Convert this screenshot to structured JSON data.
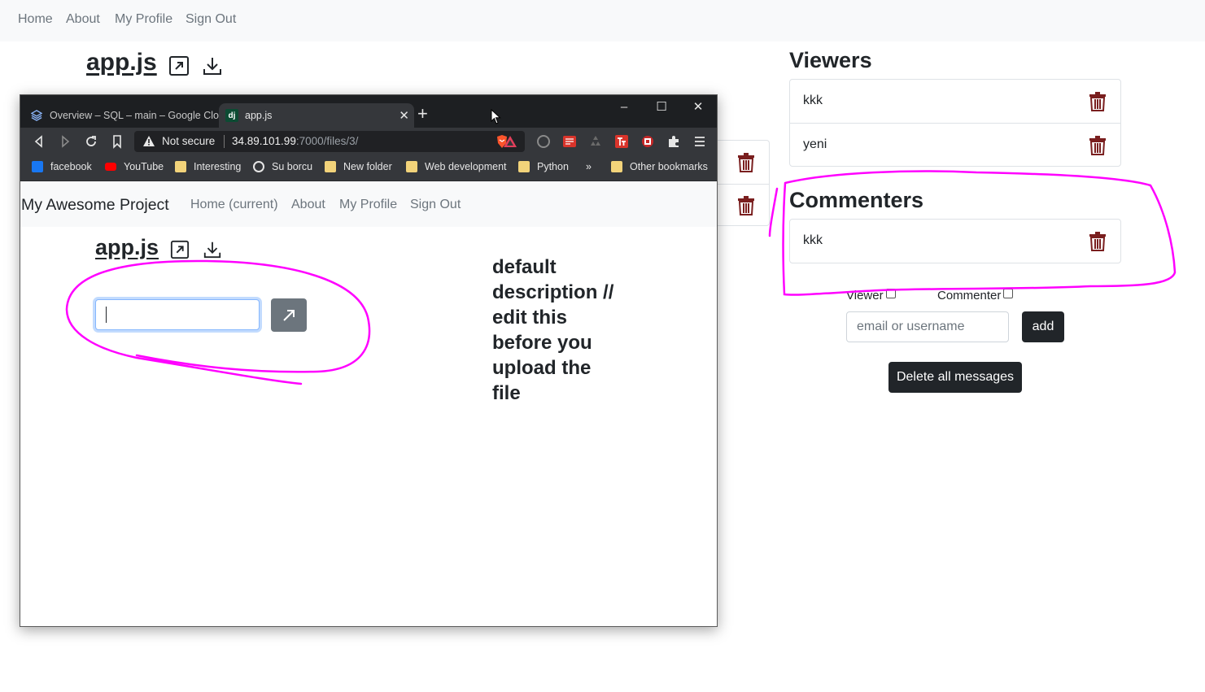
{
  "outer_nav": {
    "items": [
      "Home",
      "About",
      "My Profile",
      "Sign Out"
    ]
  },
  "outer_file": {
    "title": "app.js"
  },
  "viewers": {
    "title": "Viewers",
    "items": [
      "kkk",
      "yeni"
    ]
  },
  "commenters": {
    "title": "Commenters",
    "items": [
      "kkk"
    ]
  },
  "invite": {
    "viewer_label": "Viewer",
    "commenter_label": "Commenter",
    "placeholder": "email or username",
    "add_label": "add",
    "delete_all_label": "Delete all messages"
  },
  "browser": {
    "tabs": [
      {
        "label": "Overview – SQL – main – Google Cloud",
        "active": false
      },
      {
        "label": "app.js",
        "active": true
      }
    ],
    "address": {
      "security_label": "Not secure",
      "host": "34.89.101.99",
      "path": ":7000/files/3/"
    },
    "bookmarks": [
      "facebook",
      "YouTube",
      "Interesting",
      "Su borcu",
      "New folder",
      "Web development",
      "Python",
      "»",
      "Other bookmarks"
    ]
  },
  "inner_page": {
    "brand": "My Awesome Project",
    "nav": [
      "Home (current)",
      "About",
      "My Profile",
      "Sign Out"
    ],
    "file_title": "app.js",
    "input_value": "",
    "description": "default description // edit this before you upload the file"
  },
  "colors": {
    "annotation": "#ff00ff",
    "trash": "#7a1f1f",
    "dark_button": "#212529",
    "nav_bg": "#f8f9fa",
    "link_muted": "#6c757d"
  },
  "icons": [
    "external-link-icon",
    "download-icon",
    "trash-icon",
    "arrow-up-right-icon",
    "warning-icon",
    "brave-lion-icon",
    "puzzle-icon",
    "menu-icon",
    "folder-icon",
    "globe-icon",
    "youtube-icon",
    "facebook-icon",
    "mouse-cursor-icon"
  ]
}
